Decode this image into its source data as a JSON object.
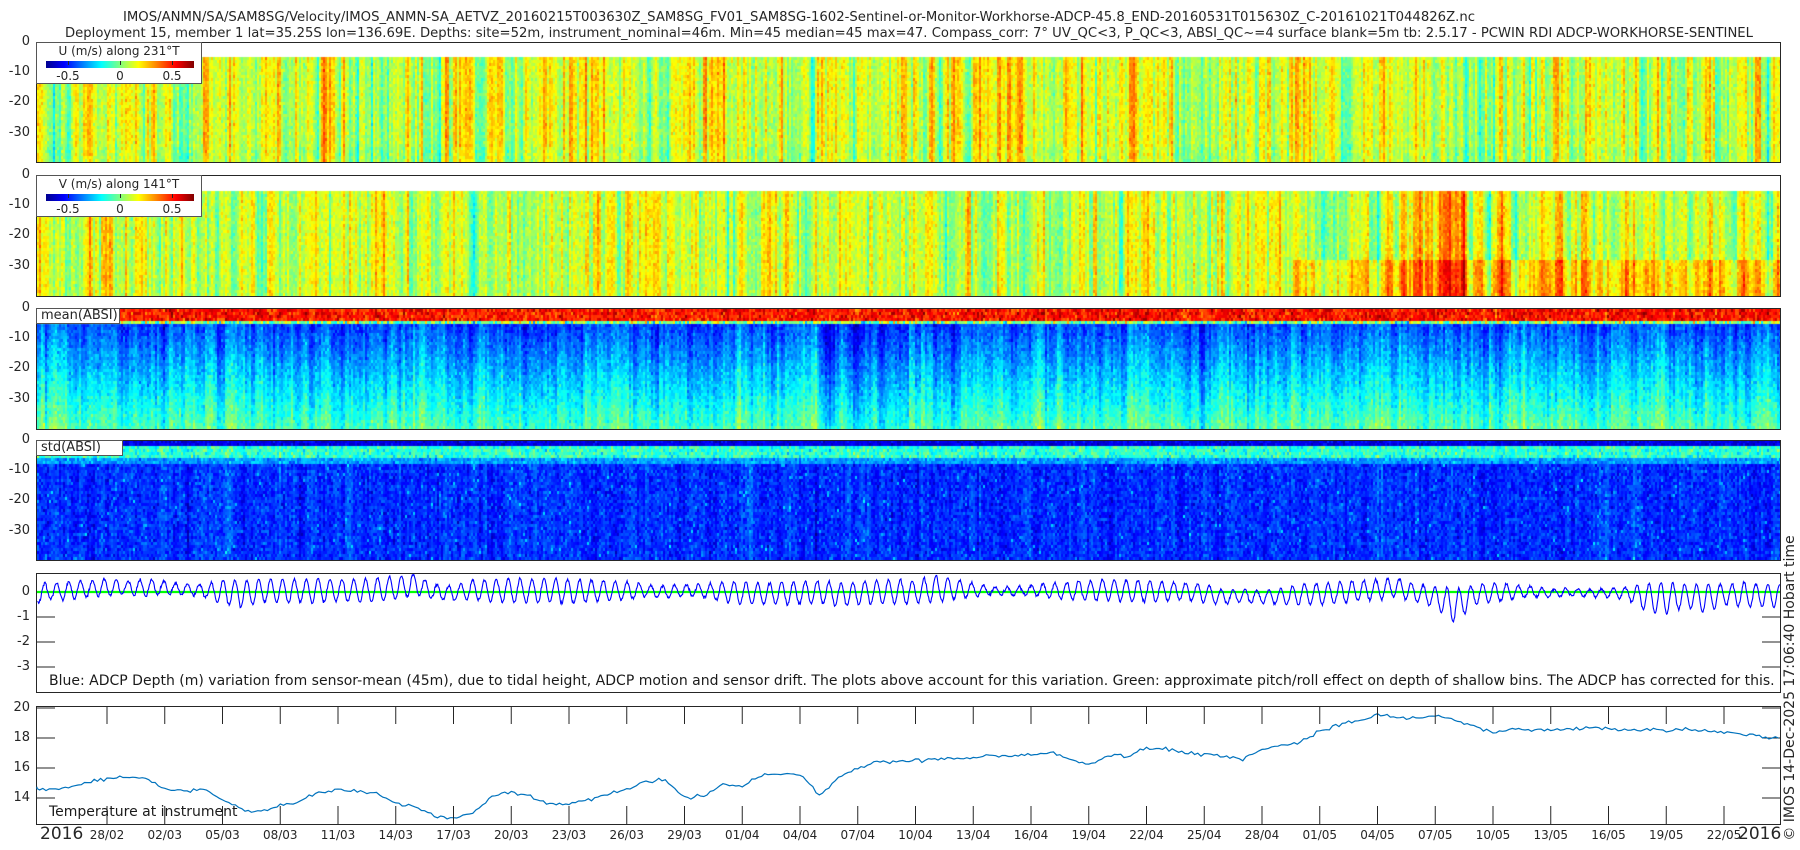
{
  "title": {
    "line1": "IMOS/ANMN/SA/SAM8SG/Velocity/IMOS_ANMN-SA_AETVZ_20160215T003630Z_SAM8SG_FV01_SAM8SG-1602-Sentinel-or-Monitor-Workhorse-ADCP-45.8_END-20160531T015630Z_C-20161021T044826Z.nc",
    "line2": "Deployment 15, member 1 lat=35.25S lon=136.69E. Depths: site=52m, instrument_nominal=46m. Min=45 median=45 max=47. Compass_corr: 7° UV_QC<3, P_QC<3, ABSI_QC~=4 surface blank=5m tb: 2.5.17 - PCWIN RDI ADCP-WORKHORSE-SENTINEL"
  },
  "copyright": "© IMOS 14-Dec-2025 17:06:40 Hobart time",
  "xaxis": {
    "xlim": [
      "2016-02-24",
      "2016-05-25"
    ],
    "ticks": [
      "28/02",
      "02/03",
      "05/03",
      "08/03",
      "11/03",
      "14/03",
      "17/03",
      "20/03",
      "23/03",
      "26/03",
      "29/03",
      "01/04",
      "04/04",
      "07/04",
      "10/04",
      "13/04",
      "16/04",
      "19/04",
      "22/04",
      "25/04",
      "28/04",
      "01/05",
      "04/05",
      "07/05",
      "10/05",
      "13/05",
      "16/05",
      "19/05",
      "22/05"
    ],
    "year_left": "2016",
    "year_right": "2016"
  },
  "chart_data": [
    {
      "type": "heatmap",
      "colorbar_label": "U (m/s) along 231°T",
      "colormap": "jet",
      "clim": [
        -0.71,
        0.71
      ],
      "colorbar_ticks": [
        "-0.5",
        "0",
        "0.5"
      ],
      "ylim": [
        -40,
        0
      ],
      "yticks": [
        "0",
        "-10",
        "-20",
        "-30"
      ],
      "surface_blank_m": 5
    },
    {
      "type": "heatmap",
      "colorbar_label": "V (m/s) along 141°T",
      "colormap": "jet",
      "clim": [
        -0.71,
        0.71
      ],
      "colorbar_ticks": [
        "-0.5",
        "0",
        "0.5"
      ],
      "ylim": [
        -40,
        0
      ],
      "yticks": [
        "0",
        "-10",
        "-20",
        "-30"
      ],
      "surface_blank_m": 5
    },
    {
      "type": "heatmap",
      "label": "mean(ABSI)",
      "colormap": "jet",
      "ylim": [
        -40,
        0
      ],
      "yticks": [
        "0",
        "-10",
        "-20",
        "-30"
      ]
    },
    {
      "type": "heatmap",
      "label": "std(ABSI)",
      "colormap": "jet",
      "ylim": [
        -40,
        0
      ],
      "yticks": [
        "0",
        "-10",
        "-20",
        "-30"
      ]
    },
    {
      "type": "line",
      "annotation": "Blue: ADCP Depth (m) variation from sensor-mean (45m), due to tidal height, ADCP motion and sensor drift. The plots above account for this variation. Green: approximate pitch/roll effect on depth of shallow bins. The ADCP has corrected for this.",
      "ylim": [
        -4.0,
        0.76
      ],
      "yticks": [
        "0",
        "-1",
        "-2",
        "-3"
      ],
      "series": [
        {
          "color": "#0000ff",
          "daily_max": [
            0.4,
            0.35,
            0.4,
            0.45,
            0.5,
            0.45,
            0.5,
            0.45,
            0.3,
            0.3,
            0.5,
            0.45,
            0.5,
            0.55,
            0.5,
            0.55,
            0.5,
            0.5,
            0.55,
            0.6,
            0.7,
            0.3,
            0.25,
            0.45,
            0.5,
            0.55,
            0.5,
            0.55,
            0.5,
            0.5,
            0.45,
            0.4,
            0.3,
            0.25,
            0.3,
            0.3,
            0.4,
            0.4,
            0.35,
            0.4,
            0.4,
            0.45,
            0.35,
            0.4,
            0.45,
            0.5,
            0.45,
            0.65,
            0.55,
            0.35,
            0.2,
            0.2,
            0.25,
            0.35,
            0.4,
            0.45,
            0.5,
            0.5,
            0.45,
            0.4,
            0.35,
            0.3,
            0.1,
            0.1,
            0.05,
            0.15,
            0.3,
            0.35,
            0.4,
            0.45,
            0.5,
            0.55,
            0.3,
            0.2,
            0.1,
            0.3,
            0.35,
            0.3,
            0.2,
            0.1,
            0.15,
            0.1,
            0.15,
            0.2,
            0.35,
            0.4,
            0.3,
            0.35,
            0.3,
            0.4,
            0.3
          ],
          "daily_min": [
            -0.55,
            -0.3,
            -0.3,
            -0.2,
            -0.15,
            -0.1,
            -0.15,
            -0.1,
            -0.1,
            -0.2,
            -0.5,
            -0.6,
            -0.4,
            -0.45,
            -0.4,
            -0.45,
            -0.35,
            -0.4,
            -0.4,
            -0.3,
            -0.1,
            -0.3,
            -0.35,
            -0.3,
            -0.4,
            -0.4,
            -0.45,
            -0.4,
            -0.45,
            -0.4,
            -0.35,
            -0.3,
            -0.2,
            -0.25,
            -0.15,
            -0.2,
            -0.4,
            -0.5,
            -0.45,
            -0.5,
            -0.5,
            -0.45,
            -0.55,
            -0.5,
            -0.45,
            -0.5,
            -0.45,
            -0.4,
            -0.3,
            -0.2,
            -0.1,
            -0.15,
            -0.1,
            -0.25,
            -0.3,
            -0.35,
            -0.35,
            -0.4,
            -0.4,
            -0.35,
            -0.3,
            -0.4,
            -0.5,
            -0.4,
            -0.45,
            -0.5,
            -0.5,
            -0.5,
            -0.45,
            -0.35,
            -0.3,
            -0.2,
            -0.4,
            -0.6,
            -1.25,
            -0.5,
            -0.4,
            -0.3,
            -0.2,
            -0.2,
            -0.15,
            -0.2,
            -0.2,
            -0.3,
            -0.8,
            -0.9,
            -0.6,
            -0.85,
            -0.5,
            -0.6,
            -0.6
          ]
        },
        {
          "color": "#00ff00",
          "value": 0
        }
      ]
    },
    {
      "type": "line",
      "annotation": "Temperature at instrument",
      "ylim": [
        12.27,
        20.1
      ],
      "yticks": [
        "20",
        "18",
        "16",
        "14"
      ],
      "color": "#0072bd",
      "x": [
        "2016-02-24",
        "2016-02-25",
        "2016-02-26",
        "2016-02-27",
        "2016-02-28",
        "2016-02-29",
        "2016-03-01",
        "2016-03-02",
        "2016-03-03",
        "2016-03-04",
        "2016-03-05",
        "2016-03-06",
        "2016-03-07",
        "2016-03-08",
        "2016-03-09",
        "2016-03-10",
        "2016-03-11",
        "2016-03-12",
        "2016-03-13",
        "2016-03-14",
        "2016-03-15",
        "2016-03-16",
        "2016-03-17",
        "2016-03-18",
        "2016-03-19",
        "2016-03-20",
        "2016-03-21",
        "2016-03-22",
        "2016-03-23",
        "2016-03-24",
        "2016-03-25",
        "2016-03-26",
        "2016-03-27",
        "2016-03-28",
        "2016-03-29",
        "2016-03-30",
        "2016-03-31",
        "2016-04-01",
        "2016-04-02",
        "2016-04-03",
        "2016-04-04",
        "2016-04-05",
        "2016-04-06",
        "2016-04-07",
        "2016-04-08",
        "2016-04-09",
        "2016-04-10",
        "2016-04-11",
        "2016-04-12",
        "2016-04-13",
        "2016-04-14",
        "2016-04-15",
        "2016-04-16",
        "2016-04-17",
        "2016-04-18",
        "2016-04-19",
        "2016-04-20",
        "2016-04-21",
        "2016-04-22",
        "2016-04-23",
        "2016-04-24",
        "2016-04-25",
        "2016-04-26",
        "2016-04-27",
        "2016-04-28",
        "2016-04-29",
        "2016-04-30",
        "2016-05-01",
        "2016-05-02",
        "2016-05-03",
        "2016-05-04",
        "2016-05-05",
        "2016-05-06",
        "2016-05-07",
        "2016-05-08",
        "2016-05-09",
        "2016-05-10",
        "2016-05-11",
        "2016-05-12",
        "2016-05-13",
        "2016-05-14",
        "2016-05-15",
        "2016-05-16",
        "2016-05-17",
        "2016-05-18",
        "2016-05-19",
        "2016-05-20",
        "2016-05-21",
        "2016-05-22",
        "2016-05-23",
        "2016-05-24",
        "2016-05-25"
      ],
      "values": [
        14.7,
        14.5,
        14.7,
        15.0,
        15.3,
        15.4,
        15.3,
        14.6,
        14.5,
        14.6,
        13.9,
        13.2,
        13.1,
        13.5,
        13.8,
        14.4,
        14.6,
        14.5,
        14.3,
        13.6,
        13.4,
        12.8,
        12.7,
        13.0,
        14.1,
        14.4,
        14.1,
        13.6,
        13.6,
        13.9,
        14.2,
        14.6,
        15.1,
        15.2,
        14.1,
        14.1,
        14.9,
        14.8,
        15.5,
        15.6,
        15.6,
        14.2,
        15.3,
        16.0,
        16.4,
        16.4,
        16.5,
        16.6,
        16.6,
        16.7,
        16.8,
        16.8,
        16.9,
        17.1,
        16.6,
        16.2,
        16.8,
        16.8,
        17.3,
        17.3,
        17.0,
        16.9,
        16.8,
        16.6,
        17.3,
        17.5,
        17.7,
        18.5,
        18.9,
        19.1,
        19.5,
        19.4,
        19.3,
        19.5,
        19.2,
        18.8,
        18.4,
        18.6,
        18.5,
        18.6,
        18.6,
        18.7,
        18.6,
        18.5,
        18.6,
        18.5,
        18.6,
        18.5,
        18.4,
        18.3,
        18.1,
        18.0
      ]
    }
  ]
}
